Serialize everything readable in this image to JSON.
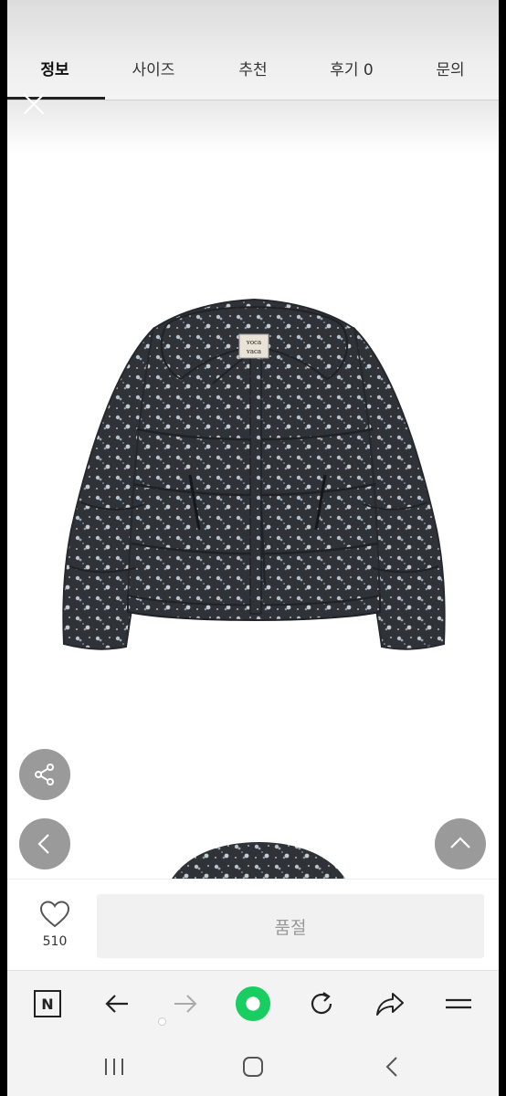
{
  "tabs": [
    {
      "label": "정보",
      "active": true
    },
    {
      "label": "사이즈",
      "active": false
    },
    {
      "label": "추천",
      "active": false
    },
    {
      "label": "후기 0",
      "active": false
    },
    {
      "label": "문의",
      "active": false
    }
  ],
  "product": {
    "brand_label_line1": "voca",
    "brand_label_line2": "vaca",
    "description": "floral print puffer jacket"
  },
  "like": {
    "count": "510",
    "icon": "heart-outline-icon"
  },
  "buy": {
    "label": "품절"
  },
  "browser_toolbar": {
    "icons": [
      "naver-n-icon",
      "back-arrow-icon",
      "forward-arrow-icon",
      "green-circle-home-icon",
      "reload-icon",
      "share-arrow-icon",
      "menu-icon"
    ],
    "n_label": "N"
  },
  "colors": {
    "accent_green": "#19ce60",
    "float_button": "#8a8a8a",
    "soldout_bg": "#f1f1f1"
  }
}
